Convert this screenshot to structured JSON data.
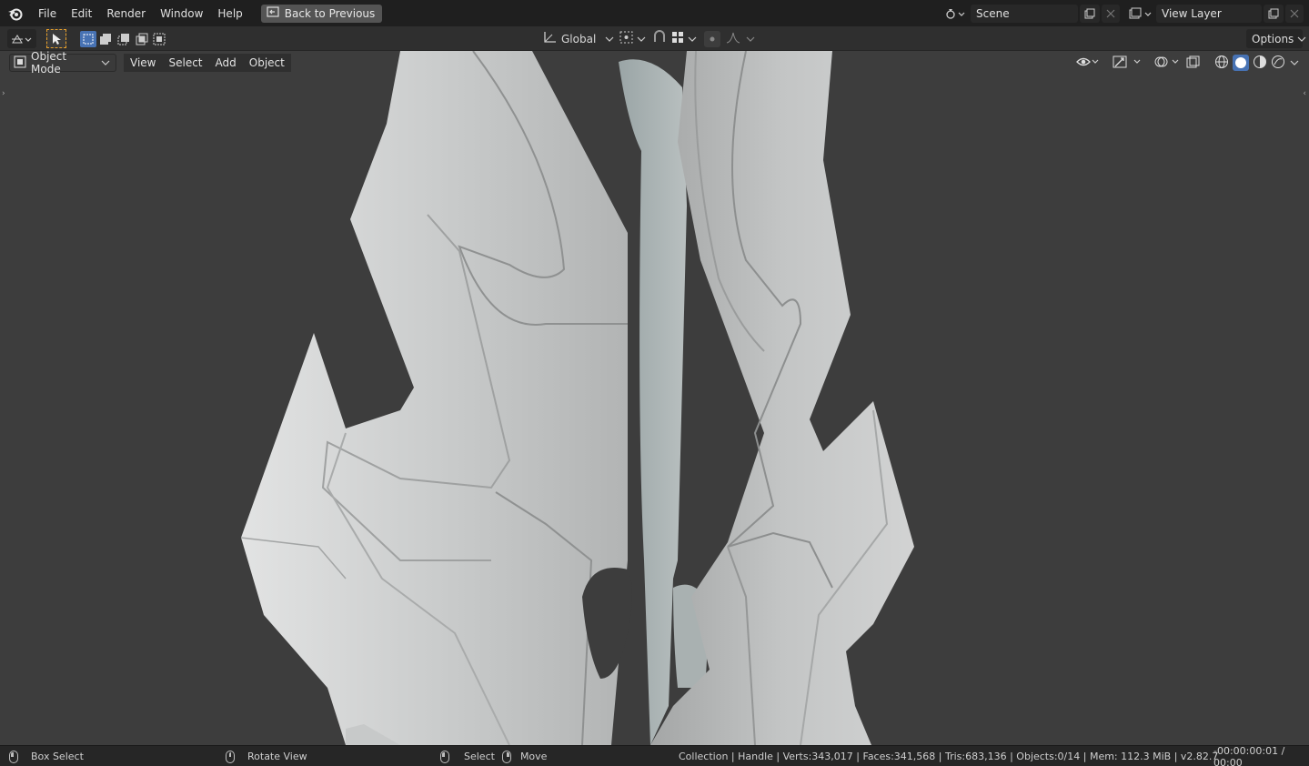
{
  "menu": {
    "items": [
      "File",
      "Edit",
      "Render",
      "Window",
      "Help"
    ],
    "back_button": "Back to Previous"
  },
  "scene": {
    "name": "Scene"
  },
  "view_layer": {
    "name": "View Layer"
  },
  "tool_header": {
    "orientation": "Global",
    "options": "Options"
  },
  "viewport": {
    "mode": "Object Mode",
    "menus": [
      "View",
      "Select",
      "Add",
      "Object"
    ]
  },
  "status": {
    "left_action": "Box Select",
    "middle_action": "Rotate View",
    "right_select": "Select",
    "right_move": "Move",
    "stats": "Collection | Handle | Verts:343,017 | Faces:341,568 | Tris:683,136 | Objects:0/14 | Mem: 112.3 MiB | v2.82.7",
    "time": "-00:00:00:01 / 00:00"
  },
  "colors": {
    "accent": "#4772b3",
    "viewport_bg": "#3d3d3d",
    "mesh": "#c4c6c6",
    "select_tool": "#e8a02c"
  }
}
